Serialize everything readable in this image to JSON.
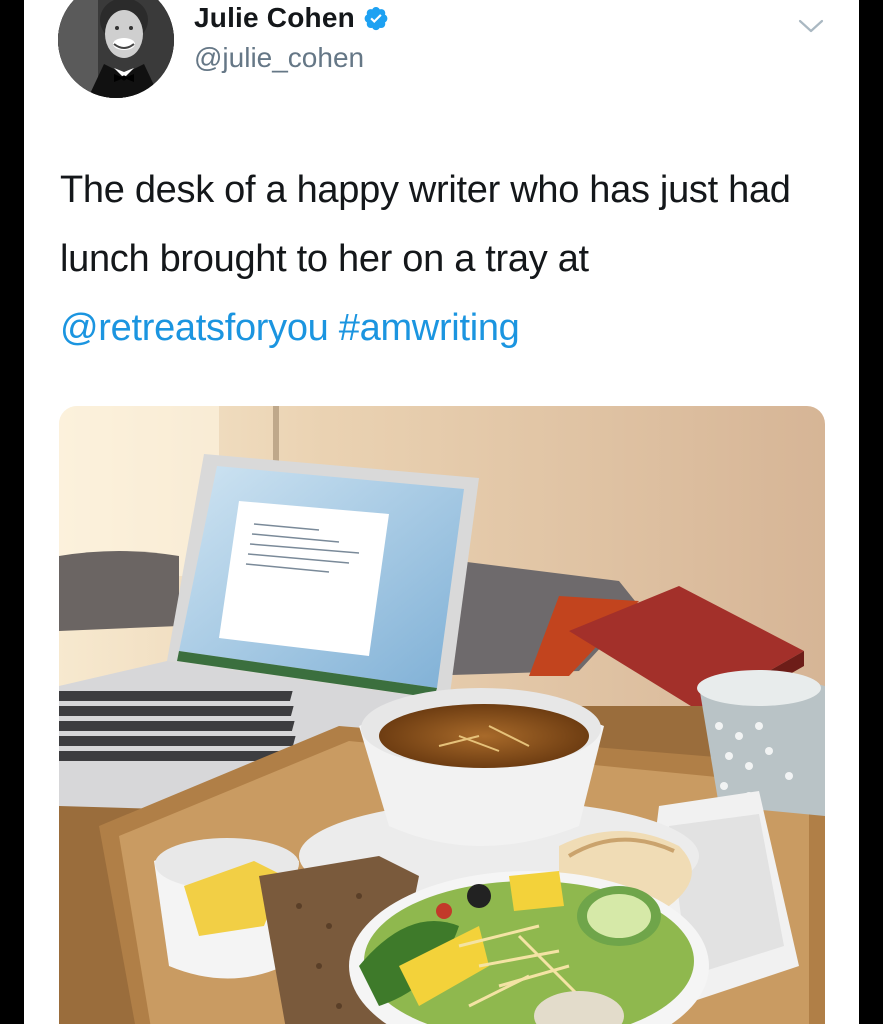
{
  "user": {
    "display_name": "Julie Cohen",
    "handle": "@julie_cohen",
    "verified": true,
    "avatar_icon": "profile-photo"
  },
  "tweet": {
    "text_parts": [
      "The desk of a happy writer who has just had lunch brought to her on a tray at ",
      "@retreatsforyou",
      " ",
      "#amwriting"
    ],
    "mention": "@retreatsforyou",
    "hashtag": "#amwriting"
  },
  "menu": {
    "icon": "chevron-down-icon"
  },
  "media": {
    "icon": "photo"
  },
  "colors": {
    "link": "#1b95e0",
    "verified": "#1da1f2",
    "text": "#14171a",
    "secondary": "#657786",
    "background": "#ffffff",
    "frame": "#000000"
  }
}
